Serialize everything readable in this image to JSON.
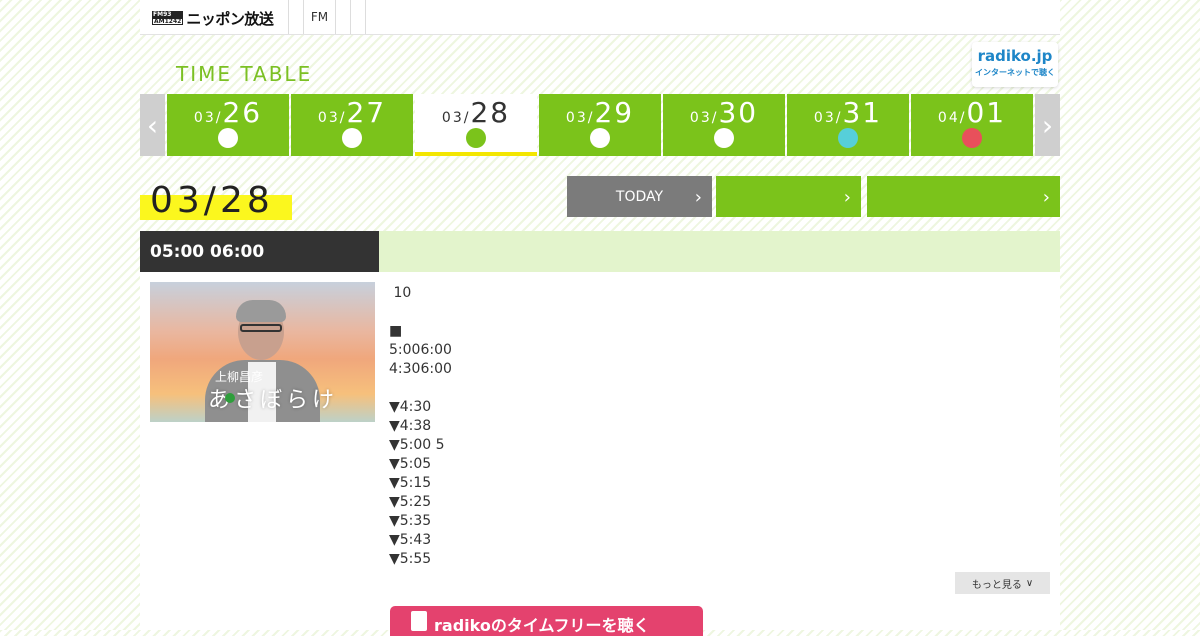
{
  "header": {
    "logo_badge_top": "FM93",
    "logo_badge_bottom": "AM1242",
    "logo_text": "ニッポン放送",
    "nav_fm": "FM",
    "radiko_title": "radiko.jp",
    "radiko_sub": "インターネットで聴く"
  },
  "timetable": {
    "title": "TIME TABLE",
    "days": [
      {
        "month": "03/",
        "day": "26",
        "kind": "weekday"
      },
      {
        "month": "03/",
        "day": "27",
        "kind": "weekday"
      },
      {
        "month": "03/",
        "day": "28",
        "kind": "weekday",
        "active": true
      },
      {
        "month": "03/",
        "day": "29",
        "kind": "weekday"
      },
      {
        "month": "03/",
        "day": "30",
        "kind": "weekday"
      },
      {
        "month": "03/",
        "day": "31",
        "kind": "saturday"
      },
      {
        "month": "04/",
        "day": "01",
        "kind": "sunday"
      }
    ],
    "selected_date": "03/28",
    "today_label": "TODAY",
    "btn2_label": "",
    "btn3_label": ""
  },
  "program": {
    "time": "05:00  06:00",
    "title": "",
    "thumb_caption_small": "上柳昌彦",
    "thumb_caption_large": "あさぼらけ",
    "description": [
      " 10",
      "",
      "■",
      "5:006:00",
      "4:306:00",
      "",
      "▼4:30",
      "▼4:38",
      "▼5:00 5",
      "▼5:05",
      "▼5:15",
      "▼5:25",
      "▼5:35",
      "▼5:43",
      "▼5:55"
    ],
    "more_label": "もっと見る",
    "radiko_button_label": "radikoのタイムフリーを聴く"
  },
  "colors": {
    "accent_green": "#7bc31b",
    "highlight_yellow": "#fbf71e",
    "saturday": "#56cfd9",
    "sunday": "#e8505b",
    "radiko_pink": "#e4426e"
  }
}
